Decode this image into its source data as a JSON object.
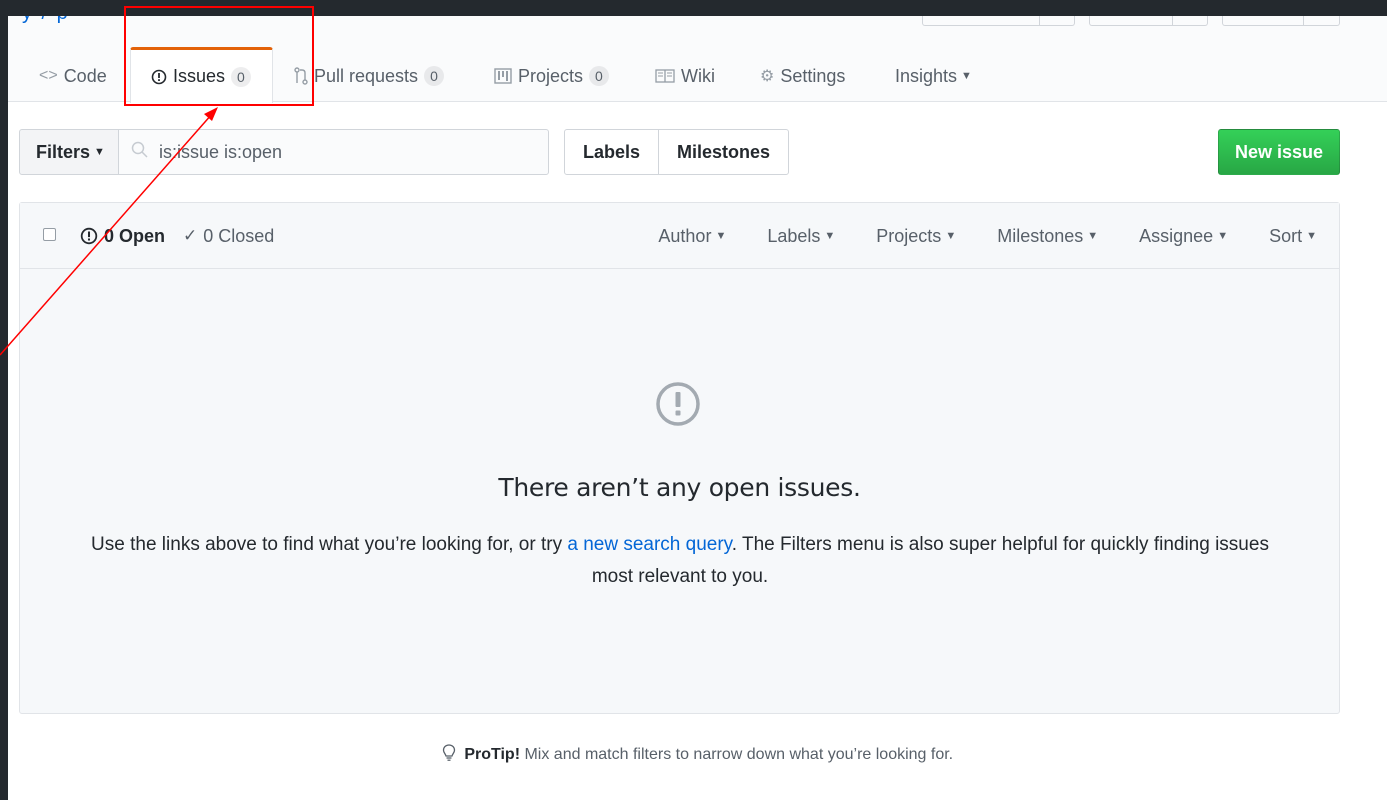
{
  "repo": {
    "title_fragment": "y / p"
  },
  "tabs": [
    {
      "label": "Code",
      "icon": "code-icon"
    },
    {
      "label": "Issues",
      "count": "0",
      "icon": "issue-opened-icon"
    },
    {
      "label": "Pull requests",
      "count": "0",
      "icon": "git-pull-request-icon"
    },
    {
      "label": "Projects",
      "count": "0",
      "icon": "project-icon"
    },
    {
      "label": "Wiki",
      "icon": "book-icon"
    },
    {
      "label": "Settings",
      "icon": "gear-icon"
    },
    {
      "label": "Insights",
      "icon": "chevron-down-icon"
    }
  ],
  "toolbar": {
    "filters_label": "Filters",
    "search_value": "is:issue is:open",
    "labels_label": "Labels",
    "milestones_label": "Milestones",
    "new_issue_label": "New issue"
  },
  "issues_header": {
    "open_label": "0 Open",
    "closed_label": "0 Closed",
    "menus": [
      "Author",
      "Labels",
      "Projects",
      "Milestones",
      "Assignee",
      "Sort"
    ]
  },
  "blankslate": {
    "title": "There aren’t any open issues.",
    "text_before": "Use the links above to find what you’re looking for, or try ",
    "link": "a new search query",
    "text_after": ". The Filters menu is also super helpful for quickly finding issues most relevant to you."
  },
  "protip": {
    "bold": "ProTip!",
    "text": " Mix and match filters to narrow down what you’re looking for."
  },
  "colors": {
    "accent": "#0366d6",
    "selected_tab_border": "#e36209",
    "new_issue_green": "#28a745",
    "annotation": "#ff0000"
  }
}
